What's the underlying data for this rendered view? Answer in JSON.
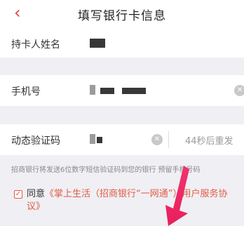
{
  "header": {
    "back_icon": "chevron-left-icon",
    "title": "填写银行卡信息"
  },
  "form": {
    "holder_label": "持卡人姓名",
    "phone_label": "手机号",
    "code_label": "动态验证码",
    "resend_text": "44秒后重发"
  },
  "hint": "招商银行将发送6位数字短信验证码到您的银行 预留手机号码",
  "agreement": {
    "prefix": "同意",
    "link": "《掌上生活（招商银行“一网通”）用户服务协议》"
  },
  "colors": {
    "accent": "#e8403a",
    "background": "#efeff4",
    "overlay_arrow": "#f0346e"
  }
}
